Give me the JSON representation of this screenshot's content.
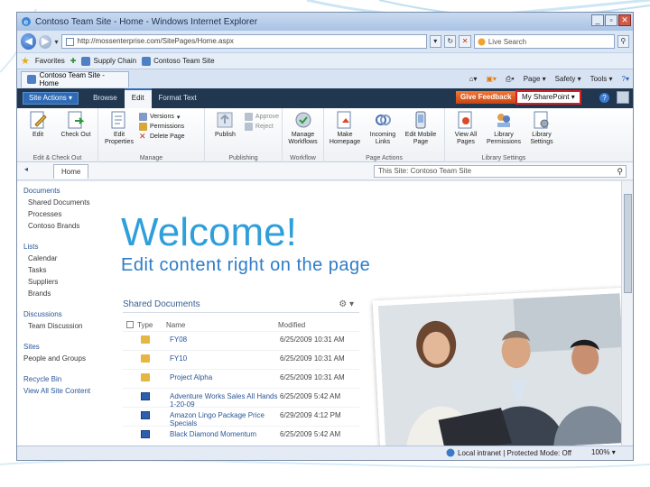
{
  "window": {
    "title": "Contoso Team Site - Home - Windows Internet Explorer"
  },
  "address": {
    "url": "http://mossenterprise.com/SitePages/Home.aspx",
    "search_placeholder": "Live Search"
  },
  "favorites": {
    "label": "Favorites",
    "items": [
      "Supply Chain",
      "Contoso Team Site"
    ]
  },
  "tab": {
    "label": "Contoso Team Site - Home"
  },
  "tab_tools": {
    "page": "Page",
    "safety": "Safety",
    "tools": "Tools"
  },
  "ribbon": {
    "site_actions": "Site Actions",
    "tabs": [
      "Browse",
      "Edit",
      "Format Text"
    ],
    "active_tab": "Edit",
    "give_feedback": "Give Feedback",
    "my_sharepoint": "My SharePoint",
    "groups": [
      {
        "name": "Edit & Check Out",
        "buttons": [
          "Edit",
          "Check Out"
        ]
      },
      {
        "name": "Manage",
        "buttons": [
          "Edit Properties"
        ],
        "small": [
          "Versions",
          "Permissions",
          "Delete Page"
        ]
      },
      {
        "name": "Publishing",
        "buttons": [
          "Publish"
        ],
        "small": [
          "Approve",
          "Reject"
        ]
      },
      {
        "name": "Workflow",
        "buttons": [
          "Manage Workflows"
        ]
      },
      {
        "name": "Page Actions",
        "buttons": [
          "Make Homepage",
          "Incoming Links",
          "Edit Mobile Page"
        ]
      },
      {
        "name": "Library Settings",
        "buttons": [
          "View All Pages",
          "Library Permissions",
          "Library Settings"
        ]
      }
    ]
  },
  "breadcrumb": {
    "home_tab": "Home",
    "site_search_placeholder": "This Site: Contoso Team Site"
  },
  "quicklaunch": {
    "documents_head": "Documents",
    "documents": [
      "Shared Documents",
      "Processes",
      "Contoso Brands"
    ],
    "lists_head": "Lists",
    "lists": [
      "Calendar",
      "Tasks",
      "Suppliers",
      "Brands"
    ],
    "discussions_head": "Discussions",
    "discussions": [
      "Team Discussion"
    ],
    "sites_head": "Sites",
    "sites": [
      "People and Groups"
    ],
    "recycle_bin": "Recycle Bin",
    "view_all": "View All Site Content"
  },
  "main": {
    "welcome": "Welcome!",
    "subtitle": "Edit content right on the page"
  },
  "shared_docs": {
    "title": "Shared Documents",
    "columns": {
      "type": "Type",
      "name": "Name",
      "modified": "Modified"
    },
    "rows": [
      {
        "type": "folder",
        "name": "FY08",
        "modified": "6/25/2009 10:31 AM"
      },
      {
        "type": "folder",
        "name": "FY10",
        "modified": "6/25/2009 10:31 AM"
      },
      {
        "type": "folder",
        "name": "Project Alpha",
        "modified": "6/25/2009 10:31 AM"
      },
      {
        "type": "docx",
        "name": "Adventure Works Sales All Hands 1-20-09",
        "modified": "6/25/2009 5:42 AM"
      },
      {
        "type": "docx",
        "name": "Amazon Lingo Package Price Specials",
        "modified": "6/29/2009 4:12 PM"
      },
      {
        "type": "docx",
        "name": "Black Diamond Momentum",
        "modified": "6/25/2009 5:42 AM"
      }
    ]
  },
  "status": {
    "zone": "Local intranet | Protected Mode: Off",
    "zoom": "100%"
  },
  "colors": {
    "welcome": "#2e9fdb",
    "ribbon_dark": "#21374f",
    "feedback": "#e0621f",
    "highlight_border": "#d62020"
  }
}
